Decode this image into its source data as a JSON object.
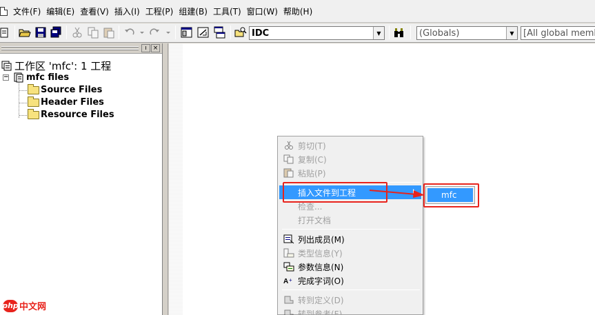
{
  "menubar": {
    "items": [
      "文件(F)",
      "编辑(E)",
      "查看(V)",
      "插入(I)",
      "工程(P)",
      "组建(B)",
      "工具(T)",
      "窗口(W)",
      "帮助(H)"
    ]
  },
  "toolbar": {
    "id_combo": "IDC",
    "globals_combo": "(Globals)",
    "members_combo": "[All global memb"
  },
  "workspace": {
    "root_label": "工作区 'mfc': 1 工程",
    "project_label": "mfc files",
    "folders": [
      "Source Files",
      "Header Files",
      "Resource Files"
    ],
    "pin_glyph": "ı",
    "close_glyph": "×",
    "collapse_glyph": "−"
  },
  "context_menu": {
    "cut": "剪切(T)",
    "copy": "复制(C)",
    "paste": "粘贴(P)",
    "insert_file": "插入文件到工程",
    "check": "检查...",
    "open_doc": "打开文档",
    "list_members": "列出成员(M)",
    "type_info": "类型信息(Y)",
    "param_info": "参数信息(N)",
    "complete_word": "完成字词(O)",
    "goto_def": "转到定义(D)",
    "goto_ref": "转到参考(F)"
  },
  "submenu": {
    "item": "mfc"
  },
  "watermark": {
    "logo": "php",
    "text": "中文网"
  },
  "colors": {
    "highlight": "#3399ff",
    "annotation_red": "#e8231c"
  }
}
